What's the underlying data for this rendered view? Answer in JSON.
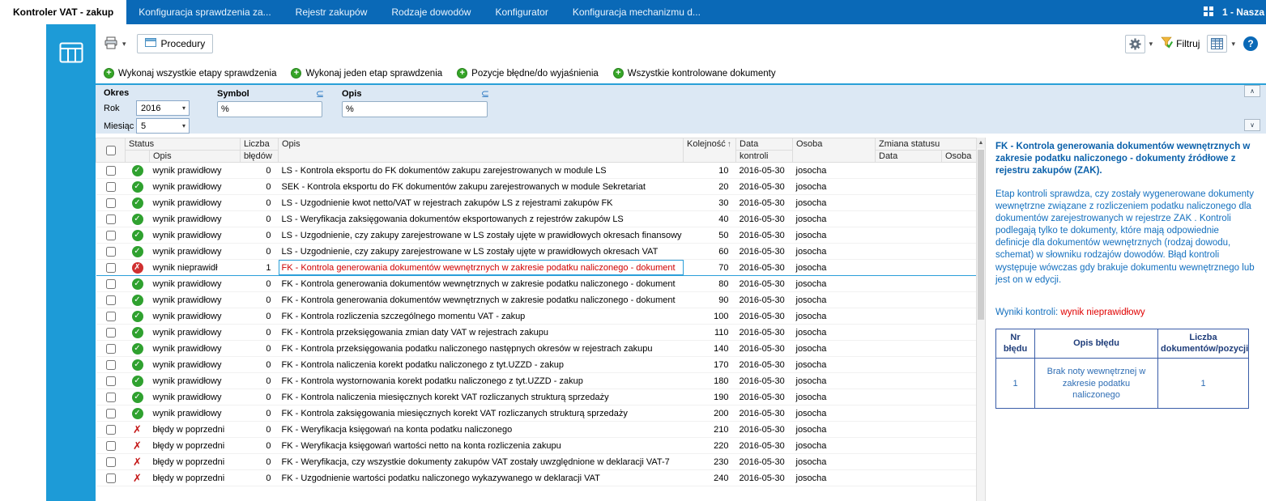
{
  "colors": {
    "topbar_blue": "#0a69b7",
    "sidebar_blue": "#1d9bd7",
    "accent_line_blue": "#29a0d8",
    "ok_green": "#2fa12f",
    "error_red": "#d03030",
    "detail_text_blue": "#1470bf",
    "result_red": "#e00000"
  },
  "topbar": {
    "tabs": [
      {
        "label": "Kontroler VAT - zakup"
      },
      {
        "label": "Konfiguracja sprawdzenia za..."
      },
      {
        "label": "Rejestr zakupów"
      },
      {
        "label": "Rodzaje dowodów"
      },
      {
        "label": "Konfigurator"
      },
      {
        "label": "Konfiguracja mechanizmu d..."
      }
    ],
    "company": "1 - Nasza"
  },
  "toolbar": {
    "procedury": "Procedury",
    "filtruj": "Filtruj"
  },
  "actions": [
    "Wykonaj wszystkie etapy sprawdzenia",
    "Wykonaj jeden etap sprawdzenia",
    "Pozycje błędne/do wyjaśnienia",
    "Wszystkie kontrolowane dokumenty"
  ],
  "filters": {
    "okres": "Okres",
    "rok_label": "Rok",
    "rok_value": "2016",
    "miesiac_label": "Miesiąc",
    "miesiac_value": "5",
    "symbol_label": "Symbol",
    "symbol_value": "%",
    "opis_label": "Opis",
    "opis_value": "%",
    "subset_symbol": "⊆"
  },
  "table": {
    "header": {
      "status": "Status",
      "status_opis": "Opis",
      "liczba": "Liczba",
      "bledow": "błędów",
      "opis": "Opis",
      "kolejnosc": "Kolejność",
      "data": "Data",
      "kontroli": "kontroli",
      "osoba": "Osoba",
      "zmiana_statusu": "Zmiana statusu",
      "zmiana_data": "Data",
      "zmiana_osoba": "Osoba"
    },
    "rows": [
      {
        "status": "ok",
        "status_text": "wynik prawidłowy",
        "errors": 0,
        "desc": "LS - Kontrola eksportu do FK dokumentów zakupu zarejestrowanych w module LS",
        "order": 10,
        "date": "2016-05-30",
        "person": "josocha"
      },
      {
        "status": "ok",
        "status_text": "wynik prawidłowy",
        "errors": 0,
        "desc": "SEK - Kontrola eksportu do FK dokumentów zakupu zarejestrowanych w module Sekretariat",
        "order": 20,
        "date": "2016-05-30",
        "person": "josocha"
      },
      {
        "status": "ok",
        "status_text": "wynik prawidłowy",
        "errors": 0,
        "desc": "LS - Uzgodnienie kwot netto/VAT w rejestrach zakupów  LS  z rejestrami zakupów FK",
        "order": 30,
        "date": "2016-05-30",
        "person": "josocha"
      },
      {
        "status": "ok",
        "status_text": "wynik prawidłowy",
        "errors": 0,
        "desc": "LS - Weryfikacja zaksięgowania dokumentów eksportowanych z rejestrów zakupów LS",
        "order": 40,
        "date": "2016-05-30",
        "person": "josocha"
      },
      {
        "status": "ok",
        "status_text": "wynik prawidłowy",
        "errors": 0,
        "desc": "LS - Uzgodnienie, czy zakupy zarejestrowane w LS zostały ujęte w prawidłowych okresach finansowy",
        "order": 50,
        "date": "2016-05-30",
        "person": "josocha"
      },
      {
        "status": "ok",
        "status_text": "wynik prawidłowy",
        "errors": 0,
        "desc": "LS - Uzgodnienie, czy zakupy zarejestrowane w LS zostały ujęte w prawidłowych okresach VAT",
        "order": 60,
        "date": "2016-05-30",
        "person": "josocha"
      },
      {
        "status": "error",
        "status_text": "wynik nieprawidł",
        "errors": 1,
        "desc": "FK - Kontrola generowania dokumentów wewnętrznych w zakresie podatku naliczonego - dokument",
        "order": 70,
        "date": "2016-05-30",
        "person": "josocha",
        "selected": true
      },
      {
        "status": "ok",
        "status_text": "wynik prawidłowy",
        "errors": 0,
        "desc": "FK - Kontrola generowania dokumentów wewnętrznych w zakresie podatku naliczonego - dokument",
        "order": 80,
        "date": "2016-05-30",
        "person": "josocha"
      },
      {
        "status": "ok",
        "status_text": "wynik prawidłowy",
        "errors": 0,
        "desc": "FK - Kontrola generowania dokumentów wewnętrznych w zakresie podatku naliczonego - dokument",
        "order": 90,
        "date": "2016-05-30",
        "person": "josocha"
      },
      {
        "status": "ok",
        "status_text": "wynik prawidłowy",
        "errors": 0,
        "desc": "FK - Kontrola rozliczenia szczególnego momentu VAT - zakup",
        "order": 100,
        "date": "2016-05-30",
        "person": "josocha"
      },
      {
        "status": "ok",
        "status_text": "wynik prawidłowy",
        "errors": 0,
        "desc": "FK - Kontrola przeksięgowania zmian daty VAT w rejestrach zakupu",
        "order": 110,
        "date": "2016-05-30",
        "person": "josocha"
      },
      {
        "status": "ok",
        "status_text": "wynik prawidłowy",
        "errors": 0,
        "desc": "FK - Kontrola przeksięgowania podatku naliczonego następnych okresów  w rejestrach zakupu",
        "order": 140,
        "date": "2016-05-30",
        "person": "josocha"
      },
      {
        "status": "ok",
        "status_text": "wynik prawidłowy",
        "errors": 0,
        "desc": "FK - Kontrola naliczenia korekt podatku naliczonego z tyt.UZZD - zakup",
        "order": 170,
        "date": "2016-05-30",
        "person": "josocha"
      },
      {
        "status": "ok",
        "status_text": "wynik prawidłowy",
        "errors": 0,
        "desc": "FK - Kontrola wystornowania korekt podatku naliczonego z tyt.UZZD - zakup",
        "order": 180,
        "date": "2016-05-30",
        "person": "josocha"
      },
      {
        "status": "ok",
        "status_text": "wynik prawidłowy",
        "errors": 0,
        "desc": "FK - Kontrola naliczenia miesięcznych korekt VAT rozliczanych strukturą sprzedaży",
        "order": 190,
        "date": "2016-05-30",
        "person": "josocha"
      },
      {
        "status": "ok",
        "status_text": "wynik prawidłowy",
        "errors": 0,
        "desc": "FK - Kontrola zaksięgowania miesięcznych korekt VAT rozliczanych strukturą sprzedaży",
        "order": 200,
        "date": "2016-05-30",
        "person": "josocha"
      },
      {
        "status": "prev",
        "status_text": "błędy w poprzedni",
        "errors": 0,
        "desc": "FK - Weryfikacja księgowań na konta podatku naliczonego",
        "order": 210,
        "date": "2016-05-30",
        "person": "josocha"
      },
      {
        "status": "prev",
        "status_text": "błędy w poprzedni",
        "errors": 0,
        "desc": "FK - Weryfikacja księgowań  wartości netto na konta  rozliczenia zakupu",
        "order": 220,
        "date": "2016-05-30",
        "person": "josocha"
      },
      {
        "status": "prev",
        "status_text": "błędy w poprzedni",
        "errors": 0,
        "desc": "FK - Weryfikacja, czy wszystkie dokumenty zakupów VAT zostały uwzględnione w deklaracji VAT-7",
        "order": 230,
        "date": "2016-05-30",
        "person": "josocha"
      },
      {
        "status": "prev",
        "status_text": "błędy w poprzedni",
        "errors": 0,
        "desc": "FK - Uzgodnienie wartości podatku naliczonego  wykazywanego w deklaracji VAT",
        "order": 240,
        "date": "2016-05-30",
        "person": "josocha"
      }
    ]
  },
  "detail": {
    "title": "FK - Kontrola generowania dokumentów wewnętrznych w zakresie podatku naliczonego - dokumenty źródłowe z rejestru zakupów (ZAK).",
    "body": "Etap kontroli sprawdza, czy zostały wygenerowane dokumenty wewnętrzne  związane z rozliczeniem podatku naliczonego dla dokumentów zarejestrowanych w rejestrze ZAK . Kontroli podlegają tylko te dokumenty, które mają odpowiednie definicje dla dokumentów wewnętrznych (rodzaj dowodu, schemat) w słowniku rodzajów dowodów.  Błąd kontroli występuje wówczas gdy brakuje dokumentu wewnętrznego lub jest on w edycji.",
    "result_label": "Wyniki kontroli: ",
    "result_value": "wynik nieprawidłowy",
    "table": {
      "headers": [
        "Nr błędu",
        "Opis błędu",
        "Liczba dokumentów/pozycji"
      ],
      "row": [
        "1",
        "Brak noty wewnętrznej w zakresie podatku naliczonego",
        "1"
      ]
    }
  }
}
